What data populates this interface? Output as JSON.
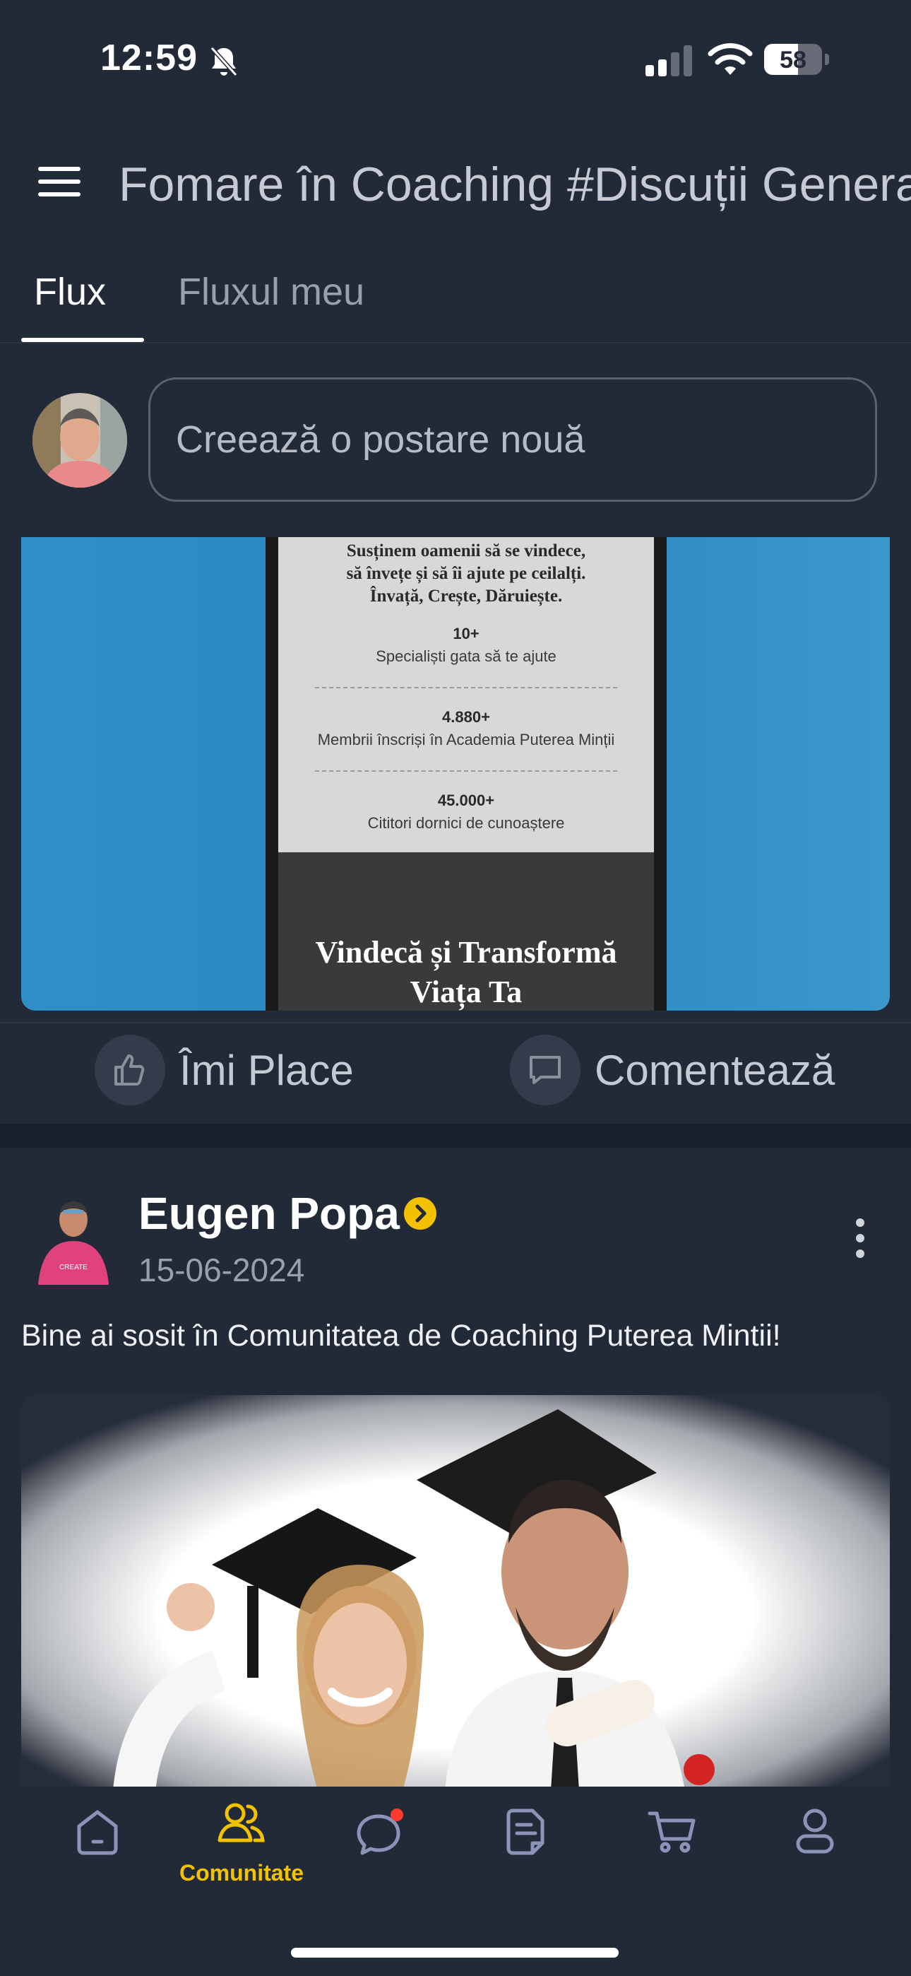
{
  "status_bar": {
    "time": "12:59",
    "battery": "58",
    "battery_fraction": 0.58
  },
  "header": {
    "title": "Fomare în Coaching #Discuții Generale"
  },
  "tabs": [
    {
      "label": "Flux",
      "active": true
    },
    {
      "label": "Fluxul meu",
      "active": false
    }
  ],
  "composer": {
    "placeholder": "Creează o postare nouă"
  },
  "post1": {
    "screenshot": {
      "intro": [
        "Susținem oamenii să se vindece,",
        "să învețe și să îi ajute pe ceilalți.",
        "Învață, Crește, Dăruiește."
      ],
      "stats": [
        {
          "number": "10+",
          "label": "Specialiști gata să te ajute"
        },
        {
          "number": "4.880+",
          "label": "Membrii înscriși în Academia Puterea Minții"
        },
        {
          "number": "45.000+",
          "label": "Cititori dornici de cunoaștere"
        }
      ],
      "heading": "Vindecă și Transformă",
      "heading_cut": "Viața Ta"
    },
    "like_label": "Îmi Place",
    "comment_label": "Comentează"
  },
  "post2": {
    "author": "Eugen Popa",
    "date": "15-06-2024",
    "text": "Bine ai sosit în Comunitatea de Coaching Puterea Mintii!"
  },
  "bottom_nav": {
    "items": [
      {
        "icon": "home-icon",
        "label": ""
      },
      {
        "icon": "community-icon",
        "label": "Comunitate",
        "active": true
      },
      {
        "icon": "chat-icon",
        "label": "",
        "badge": true
      },
      {
        "icon": "document-icon",
        "label": ""
      },
      {
        "icon": "cart-icon",
        "label": ""
      },
      {
        "icon": "profile-icon",
        "label": ""
      }
    ]
  },
  "colors": {
    "background": "#222a38",
    "accent": "#f2c200",
    "badge": "#ff3b30",
    "image_blue": "#2f8fc6"
  }
}
